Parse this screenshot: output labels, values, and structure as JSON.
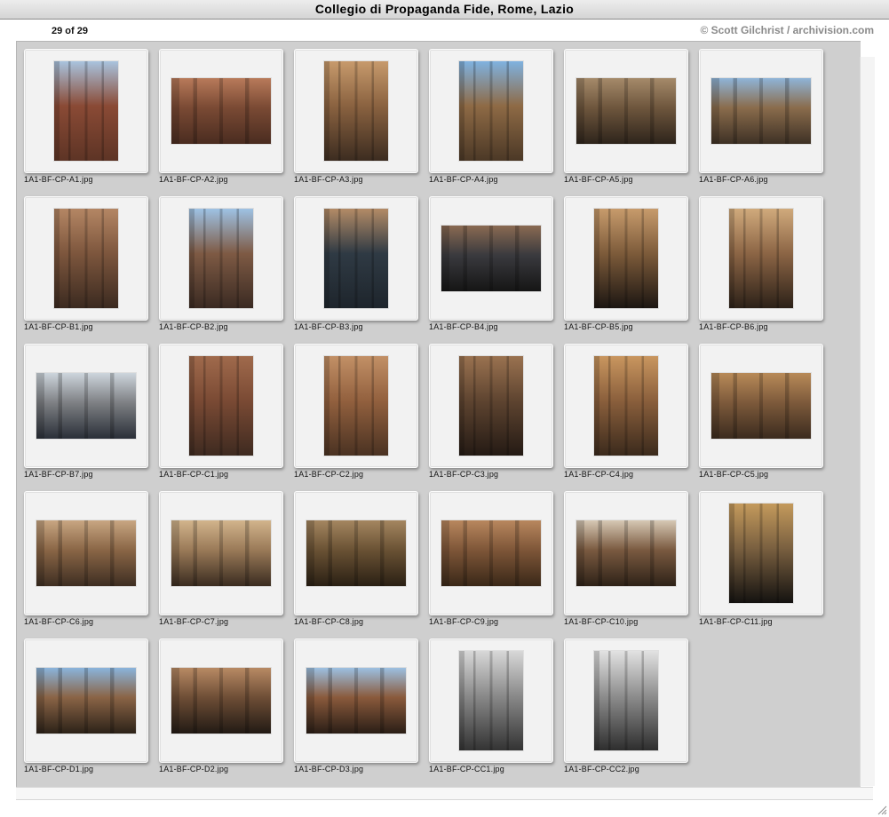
{
  "window": {
    "title": "Collegio di Propaganda Fide, Rome, Lazio"
  },
  "status": {
    "counter": "29 of 29",
    "credit": "© Scott Gilchrist / archivision.com"
  },
  "thumbnails": [
    {
      "file": "1A1-BF-CP-A1.jpg",
      "orientation": "portrait",
      "colors": [
        "#a9c3de",
        "#8a4a35",
        "#5d3425"
      ]
    },
    {
      "file": "1A1-BF-CP-A2.jpg",
      "orientation": "landscape",
      "colors": [
        "#b87a5a",
        "#7a4a34",
        "#4a2c20"
      ]
    },
    {
      "file": "1A1-BF-CP-A3.jpg",
      "orientation": "portrait",
      "colors": [
        "#c79a6c",
        "#8a6240",
        "#3c2c20"
      ]
    },
    {
      "file": "1A1-BF-CP-A4.jpg",
      "orientation": "portrait",
      "colors": [
        "#7fb2e0",
        "#8e6a45",
        "#4b3826"
      ]
    },
    {
      "file": "1A1-BF-CP-A5.jpg",
      "orientation": "landscape",
      "colors": [
        "#a58a6a",
        "#6e563d",
        "#2e241b"
      ]
    },
    {
      "file": "1A1-BF-CP-A6.jpg",
      "orientation": "landscape",
      "colors": [
        "#8fb4d8",
        "#8a6c4c",
        "#3e3125"
      ]
    },
    {
      "file": "1A1-BF-CP-B1.jpg",
      "orientation": "portrait",
      "colors": [
        "#b48664",
        "#7d563d",
        "#3b2a20"
      ]
    },
    {
      "file": "1A1-BF-CP-B2.jpg",
      "orientation": "portrait",
      "colors": [
        "#9ec2e4",
        "#7e5a44",
        "#3a2a22"
      ]
    },
    {
      "file": "1A1-BF-CP-B3.jpg",
      "orientation": "portrait",
      "colors": [
        "#b38b66",
        "#2f3a44",
        "#1e252c"
      ]
    },
    {
      "file": "1A1-BF-CP-B4.jpg",
      "orientation": "landscape",
      "colors": [
        "#8a6a52",
        "#3a3a3e",
        "#151515"
      ]
    },
    {
      "file": "1A1-BF-CP-B5.jpg",
      "orientation": "portrait",
      "colors": [
        "#c79b6c",
        "#7d5b3a",
        "#1c1612"
      ]
    },
    {
      "file": "1A1-BF-CP-B6.jpg",
      "orientation": "portrait",
      "colors": [
        "#d0aa7c",
        "#8c6545",
        "#2c2118"
      ]
    },
    {
      "file": "1A1-BF-CP-B7.jpg",
      "orientation": "landscape",
      "colors": [
        "#cdd5dc",
        "#7e8084",
        "#2a2f38"
      ]
    },
    {
      "file": "1A1-BF-CP-C1.jpg",
      "orientation": "portrait",
      "colors": [
        "#a06a4c",
        "#7a4a34",
        "#3e2a20"
      ]
    },
    {
      "file": "1A1-BF-CP-C2.jpg",
      "orientation": "portrait",
      "colors": [
        "#c29066",
        "#92603e",
        "#4a3222"
      ]
    },
    {
      "file": "1A1-BF-CP-C3.jpg",
      "orientation": "portrait",
      "colors": [
        "#9a7250",
        "#5e4430",
        "#241a14"
      ]
    },
    {
      "file": "1A1-BF-CP-C4.jpg",
      "orientation": "portrait",
      "colors": [
        "#c9965f",
        "#8a5f3c",
        "#3b2a1c"
      ]
    },
    {
      "file": "1A1-BF-CP-C5.jpg",
      "orientation": "landscape",
      "colors": [
        "#b88a58",
        "#7d5a3b",
        "#3b2b1e"
      ]
    },
    {
      "file": "1A1-BF-CP-C6.jpg",
      "orientation": "landscape",
      "colors": [
        "#c8a682",
        "#8a6646",
        "#3e2e22"
      ]
    },
    {
      "file": "1A1-BF-CP-C7.jpg",
      "orientation": "landscape",
      "colors": [
        "#d2b48c",
        "#9a7a58",
        "#3a2c20"
      ]
    },
    {
      "file": "1A1-BF-CP-C8.jpg",
      "orientation": "landscape",
      "colors": [
        "#a48660",
        "#6a5234",
        "#2a2014"
      ]
    },
    {
      "file": "1A1-BF-CP-C9.jpg",
      "orientation": "landscape",
      "colors": [
        "#b8875e",
        "#7e5638",
        "#3a2818"
      ]
    },
    {
      "file": "1A1-BF-CP-C10.jpg",
      "orientation": "landscape",
      "colors": [
        "#d6c8b4",
        "#7a5a40",
        "#2e2218"
      ]
    },
    {
      "file": "1A1-BF-CP-C11.jpg",
      "orientation": "portrait",
      "colors": [
        "#c49a5c",
        "#7a6040",
        "#141210"
      ]
    },
    {
      "file": "1A1-BF-CP-D1.jpg",
      "orientation": "landscape",
      "colors": [
        "#8ab4dc",
        "#8a6446",
        "#2c2218"
      ]
    },
    {
      "file": "1A1-BF-CP-D2.jpg",
      "orientation": "landscape",
      "colors": [
        "#b88a64",
        "#6e4e36",
        "#221a14"
      ]
    },
    {
      "file": "1A1-BF-CP-D3.jpg",
      "orientation": "landscape",
      "colors": [
        "#9cc0e2",
        "#8a5a3c",
        "#2a1e16"
      ]
    },
    {
      "file": "1A1-BF-CP-CC1.jpg",
      "orientation": "portrait",
      "colors": [
        "#d8d8d8",
        "#8a8a8a",
        "#333333"
      ]
    },
    {
      "file": "1A1-BF-CP-CC2.jpg",
      "orientation": "portrait",
      "colors": [
        "#e2e2e2",
        "#8e8e8e",
        "#2e2e2e"
      ]
    }
  ]
}
